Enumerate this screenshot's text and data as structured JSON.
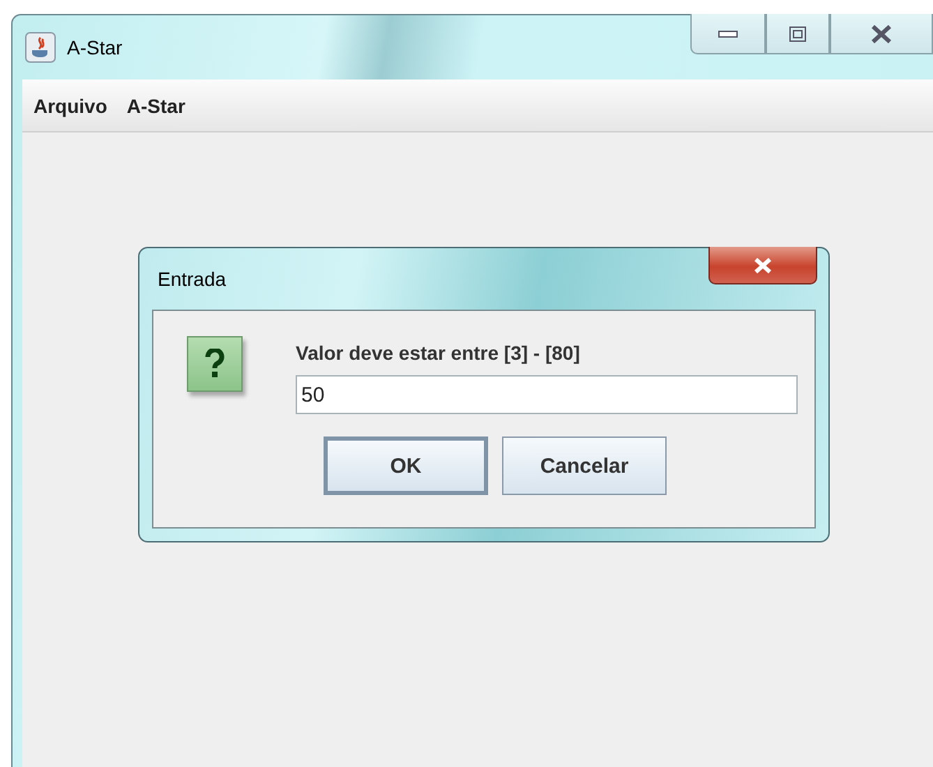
{
  "window": {
    "title": "A-Star"
  },
  "menu": [
    "Arquivo",
    "A-Star"
  ],
  "dialog": {
    "title": "Entrada",
    "message": "Valor deve estar entre [3] - [80]",
    "input": {
      "value": "50"
    },
    "buttons": [
      {
        "label": "OK",
        "default": true
      },
      {
        "label": "Cancelar",
        "default": false
      }
    ]
  }
}
